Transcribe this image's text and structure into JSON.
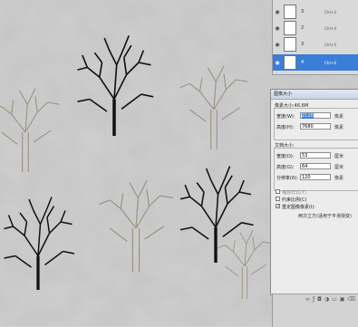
{
  "layers": [
    {
      "name": "3",
      "shortcut": "Ctrl+3",
      "selected": false
    },
    {
      "name": "2",
      "shortcut": "Ctrl+4",
      "selected": false
    },
    {
      "name": "3",
      "shortcut": "Ctrl+5",
      "selected": false
    },
    {
      "name": "4",
      "shortcut": "Ctrl+6",
      "selected": true
    }
  ],
  "dialog": {
    "title": "图像大小",
    "pixel_dim_label": "像素大小:46.6M",
    "width_label": "宽度(W):",
    "width_value": "2120",
    "width_unit": "像素",
    "height_label": "高度(H):",
    "height_value": "7680",
    "height_unit": "像素",
    "doc_size_label": "文档大小:",
    "doc_width_label": "宽度(D):",
    "doc_width_value": "53",
    "doc_width_unit": "厘米",
    "doc_height_label": "高度(G):",
    "doc_height_value": "64",
    "doc_height_unit": "厘米",
    "resolution_label": "分辨率(R):",
    "resolution_value": "120",
    "resolution_unit": "像素",
    "scale_styles_label": "缩放样式(Y)",
    "constrain_label": "约束比例(C)",
    "resample_label": "重定图像像素(I):",
    "resample_method": "两次立方(适用于平滑渐变)"
  },
  "colors": {
    "selection": "#3b7ed8",
    "canvas_bg": "#d4d4d4"
  }
}
